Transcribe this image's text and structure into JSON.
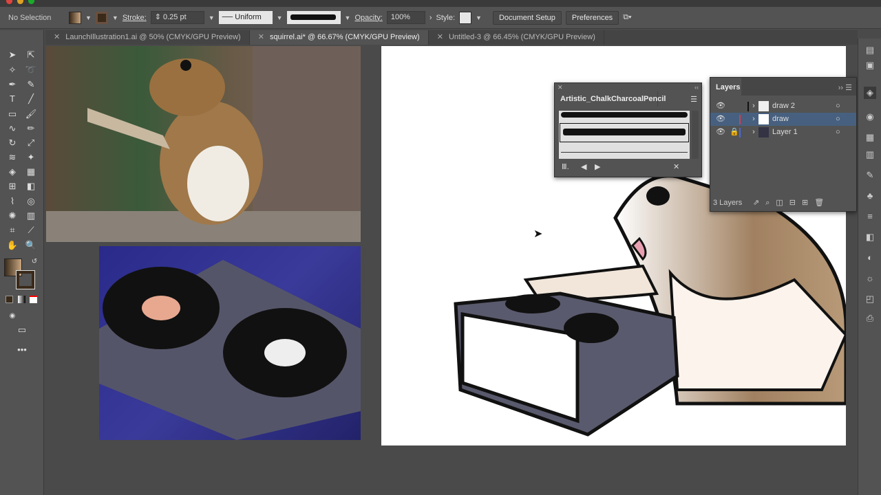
{
  "control_bar": {
    "selection": "No Selection",
    "stroke_label": "Stroke:",
    "stroke_value": "0.25 pt",
    "profile": "Uniform",
    "opacity_label": "Opacity:",
    "opacity_value": "100%",
    "style_label": "Style:",
    "document_setup": "Document Setup",
    "preferences": "Preferences"
  },
  "tabs": [
    {
      "label": "LaunchIllustration1.ai @ 50% (CMYK/GPU Preview)"
    },
    {
      "label": "squirrel.ai* @ 66.67% (CMYK/GPU Preview)"
    },
    {
      "label": "Untitled-3 @ 66.45% (CMYK/GPU Preview)"
    }
  ],
  "brush_panel": {
    "title": "Artistic_ChalkCharcoalPencil"
  },
  "layers_panel": {
    "title": "Layers",
    "layers": [
      {
        "name": "draw 2",
        "color": "#111111"
      },
      {
        "name": "draw",
        "color": "#d04050"
      },
      {
        "name": "Layer 1",
        "color": "#4a6ad8"
      }
    ],
    "count": "3 Layers"
  },
  "colors": {
    "ui": "#535353",
    "selection": "#47607f"
  }
}
